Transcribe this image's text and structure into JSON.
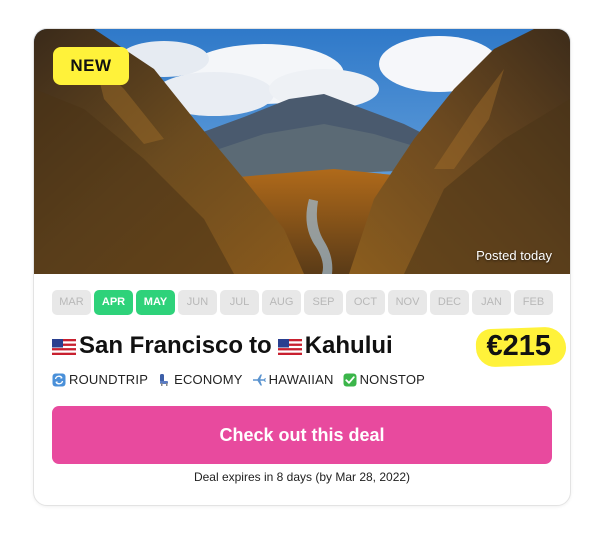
{
  "hero": {
    "badge": "NEW",
    "posted": "Posted today"
  },
  "months": [
    {
      "label": "MAR",
      "active": false
    },
    {
      "label": "APR",
      "active": true
    },
    {
      "label": "MAY",
      "active": true
    },
    {
      "label": "JUN",
      "active": false
    },
    {
      "label": "JUL",
      "active": false
    },
    {
      "label": "AUG",
      "active": false
    },
    {
      "label": "SEP",
      "active": false
    },
    {
      "label": "OCT",
      "active": false
    },
    {
      "label": "NOV",
      "active": false
    },
    {
      "label": "DEC",
      "active": false
    },
    {
      "label": "JAN",
      "active": false
    },
    {
      "label": "FEB",
      "active": false
    }
  ],
  "route": {
    "origin": "San Francisco",
    "connector": "to",
    "destination": "Kahului",
    "origin_flag": "us-flag-icon",
    "destination_flag": "us-flag-icon"
  },
  "price": "€215",
  "tags": [
    {
      "label": "ROUNDTRIP",
      "icon": "roundtrip-icon"
    },
    {
      "label": "ECONOMY",
      "icon": "seat-icon"
    },
    {
      "label": "HAWAIIAN",
      "icon": "airplane-icon"
    },
    {
      "label": "NONSTOP",
      "icon": "check-icon"
    }
  ],
  "cta": {
    "label": "Check out this deal"
  },
  "expires": "Deal expires in 8 days (by Mar 28, 2022)",
  "colors": {
    "accent_pink": "#e84a9e",
    "highlight_yellow": "#fff23a",
    "active_month_green": "#2ed27a",
    "inactive_month_bg": "#e8e8e8"
  }
}
